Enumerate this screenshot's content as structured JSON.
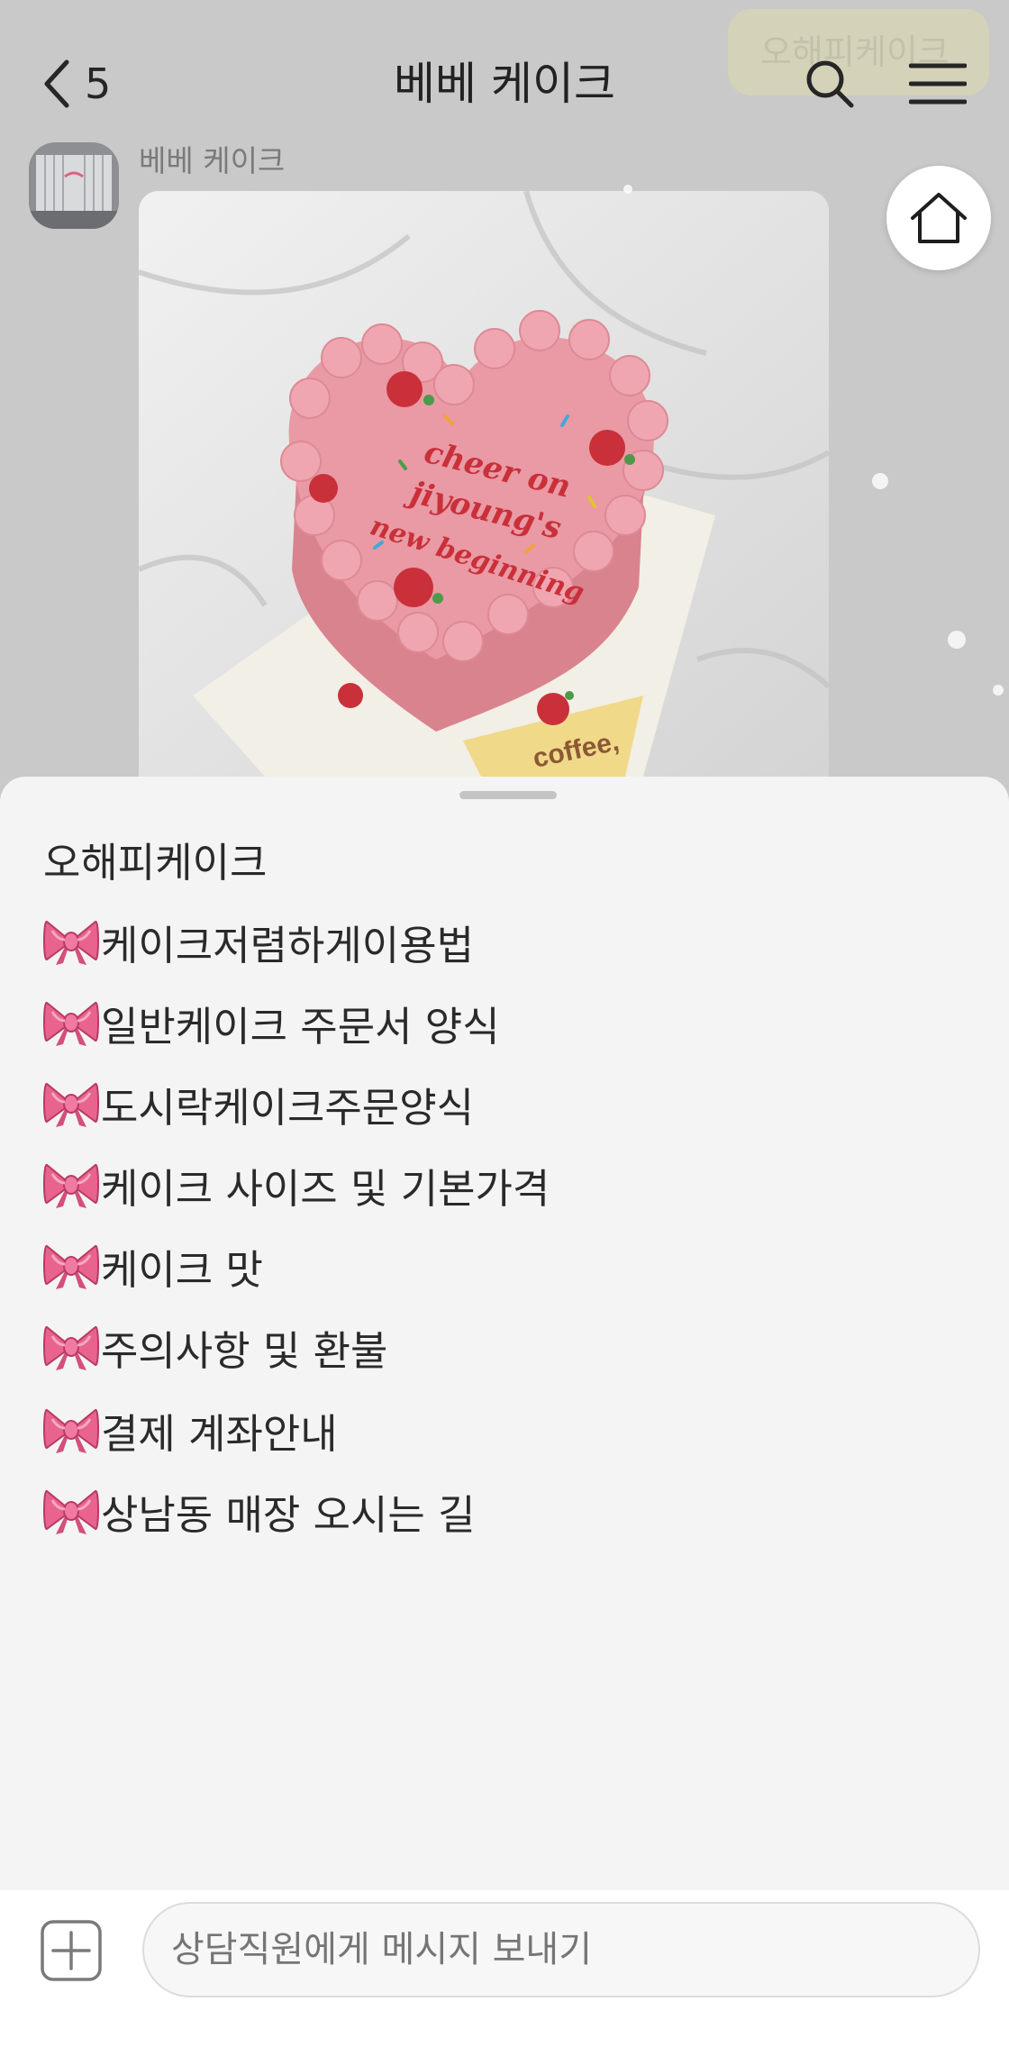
{
  "header": {
    "back_count": "5",
    "title": "베베 케이크",
    "background_bubble": "오해피케이크",
    "icons": [
      "chevron-left-icon",
      "search-icon",
      "hamburger-menu-icon",
      "home-icon"
    ]
  },
  "chat": {
    "sender_name": "베베 케이크",
    "photo_text": [
      "cheer on",
      "jiyoung's",
      "new beginning",
      "coffee,"
    ]
  },
  "sheet": {
    "items": [
      {
        "label": "오해피케이크",
        "icon": ""
      },
      {
        "label": "케이크저렴하게이용법",
        "icon": "ribbon-icon"
      },
      {
        "label": "일반케이크 주문서 양식",
        "icon": "ribbon-icon"
      },
      {
        "label": "도시락케이크주문양식",
        "icon": "ribbon-icon"
      },
      {
        "label": "케이크 사이즈 및 기본가격",
        "icon": "ribbon-icon"
      },
      {
        "label": "케이크 맛",
        "icon": "ribbon-icon"
      },
      {
        "label": "주의사항 및 환불",
        "icon": "ribbon-icon"
      },
      {
        "label": "결제 계좌안내",
        "icon": "ribbon-icon"
      },
      {
        "label": "상남동 매장 오시는 길",
        "icon": "ribbon-icon"
      }
    ]
  },
  "input": {
    "placeholder": "상담직원에게 메시지 보내기"
  },
  "colors": {
    "overlay_bg": "#c9c9c9",
    "sheet_bg": "#f4f4f4",
    "ribbon_pink": "#e8648f",
    "cake_pink": "#e99aa4",
    "cake_red": "#c9303a"
  }
}
